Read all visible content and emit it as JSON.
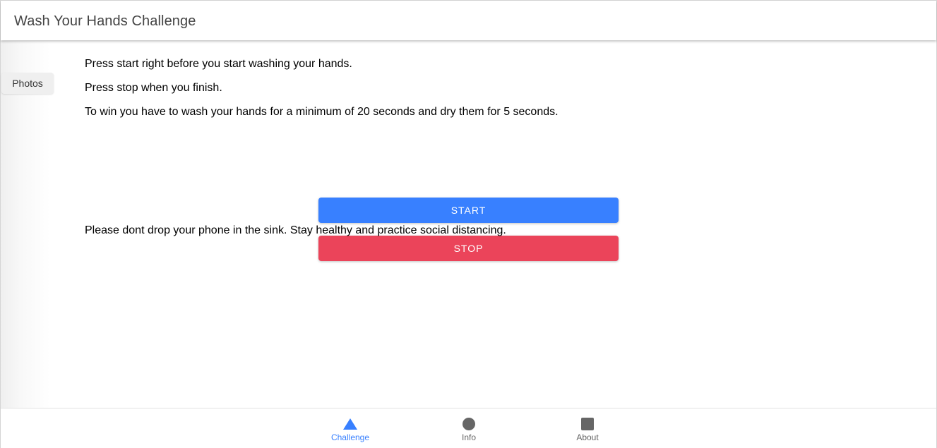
{
  "header": {
    "title": "Wash Your Hands Challenge"
  },
  "side": {
    "photos_label": "Photos"
  },
  "main": {
    "instruction_1": "Press start right before you start washing your hands.",
    "instruction_2": "Press stop when you finish.",
    "instruction_3": "To win you have to wash your hands for a minimum of 20 seconds and dry them for 5 seconds.",
    "start_label": "START",
    "stop_label": "STOP",
    "closing_note": "Please dont drop your phone in the sink. Stay healthy and practice social distancing."
  },
  "tabs": [
    {
      "label": "Challenge",
      "icon": "triangle-icon",
      "active": true
    },
    {
      "label": "Info",
      "icon": "circle-icon",
      "active": false
    },
    {
      "label": "About",
      "icon": "square-icon",
      "active": false
    }
  ],
  "colors": {
    "primary": "#3880ff",
    "danger": "#eb445a",
    "tab_inactive": "#666666"
  }
}
